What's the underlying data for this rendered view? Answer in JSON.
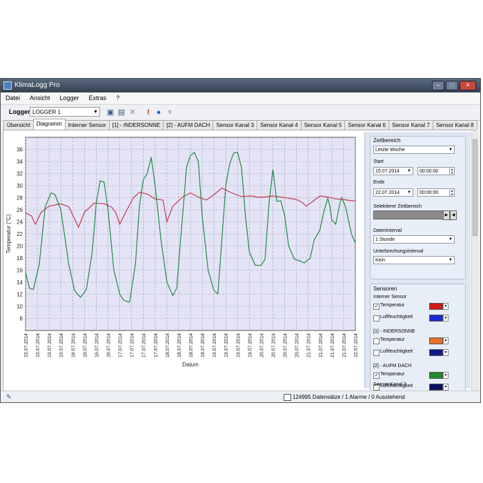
{
  "window": {
    "title": "KlimaLogg Pro",
    "controls": [
      "─",
      "□",
      "✕"
    ]
  },
  "menu": [
    "Datei",
    "Ansicht",
    "Logger",
    "Extras",
    "?"
  ],
  "toolbar": {
    "logger_label": "Logger",
    "logger_value": "LOGGER 1",
    "icons": [
      "open-folder-icon",
      "save-icon",
      "delete-x-icon",
      "alarm-exclamation-icon",
      "humidity-drop-icon",
      "sensor-key-icon"
    ]
  },
  "tabs": [
    "Übersicht",
    "Diagramm",
    "Interner Sensor",
    "[1] - INDERSONNE",
    "[2] - AUFM DACH",
    "Sensor Kanal 3",
    "Sensor Kanal 4",
    "Sensor Kanal 5",
    "Sensor Kanal 6",
    "Sensor Kanal 7",
    "Sensor Kanal 8"
  ],
  "active_tab": 1,
  "panel": {
    "zeitbereich_title": "Zeitbereich",
    "zeitbereich_value": "Letzte Woche",
    "start_label": "Start",
    "start_date": "15.07.2014",
    "start_time": "00:00:00",
    "ende_label": "Ende",
    "ende_date": "22.07.2014",
    "ende_time": "00:00:00",
    "selected_range_label": "Selektierer Zeitbereich",
    "dateninterval_label": "Dateninterval",
    "dateninterval_value": "1 Stunde",
    "unterbrechung_label": "Unterbrechungsinterval",
    "unterbrechung_value": "Kein",
    "sensoren_title": "Sensoren",
    "sensor_groups": [
      {
        "name": "Interner Sensor",
        "rows": [
          {
            "label": "Temperatur",
            "checked": true,
            "color": "#d11a1a"
          },
          {
            "label": "Luftfeuchtigkeit",
            "checked": false,
            "color": "#1a2bd1"
          }
        ]
      },
      {
        "name": "[1] - INDERSONNE",
        "rows": [
          {
            "label": "Temperatur",
            "checked": false,
            "color": "#e8702a"
          },
          {
            "label": "Luftfeuchtigkeit",
            "checked": false,
            "color": "#101a8a"
          }
        ]
      },
      {
        "name": "[2] - AUFM DACH",
        "rows": [
          {
            "label": "Temperatur",
            "checked": true,
            "color": "#1f8a2e"
          },
          {
            "label": "Luftfeuchtigkeit",
            "checked": false,
            "color": "#0a1060"
          }
        ]
      }
    ],
    "next_group_partial": "Sensor Kanal 3"
  },
  "status": {
    "text": "124995 Datensätze / 1 Alarme / 0 Ausstehend"
  },
  "chart_data": {
    "type": "line",
    "xlabel": "Datum",
    "ylabel": "Temperatur (°C)",
    "ylim": [
      6,
      38
    ],
    "yticks": [
      8,
      10,
      12,
      14,
      16,
      18,
      20,
      22,
      24,
      26,
      28,
      30,
      32,
      34,
      36
    ],
    "xlim": [
      0,
      168
    ],
    "x_tick_labels": [
      "15.07.2014",
      "15.07.2014",
      "15.07.2014",
      "15.07.2014",
      "16.07.2014",
      "16.07.2014",
      "16.07.2014",
      "16.07.2014",
      "17.07.2014",
      "17.07.2014",
      "17.07.2014",
      "17.07.2014",
      "18.07.2014",
      "18.07.2014",
      "18.07.2014",
      "18.07.2014",
      "19.07.2014",
      "19.07.2014",
      "19.07.2014",
      "19.07.2014",
      "20.07.2014",
      "20.07.2014",
      "20.07.2014",
      "20.07.2014",
      "21.07.2014",
      "21.07.2014",
      "21.07.2014",
      "21.07.2014",
      "22.07.2014"
    ],
    "x_tick_hours": [
      0,
      6,
      12,
      18,
      24,
      30,
      36,
      42,
      48,
      54,
      60,
      66,
      72,
      78,
      84,
      90,
      96,
      102,
      108,
      114,
      120,
      126,
      132,
      138,
      144,
      150,
      156,
      162,
      168
    ],
    "grid": true,
    "series": [
      {
        "color": "#c8364e",
        "points": [
          [
            0,
            25.5
          ],
          [
            3,
            25
          ],
          [
            5,
            23.6
          ],
          [
            8,
            25.6
          ],
          [
            12,
            26.6
          ],
          [
            18,
            27
          ],
          [
            22,
            26.5
          ],
          [
            25,
            24.5
          ],
          [
            27,
            23.1
          ],
          [
            30,
            25.6
          ],
          [
            35,
            27.1
          ],
          [
            40,
            27
          ],
          [
            44,
            26.4
          ],
          [
            46,
            25.5
          ],
          [
            48,
            23.6
          ],
          [
            51,
            25.6
          ],
          [
            55,
            28
          ],
          [
            58,
            28.9
          ],
          [
            62,
            28.6
          ],
          [
            66,
            27.8
          ],
          [
            70,
            27.6
          ],
          [
            72,
            24
          ],
          [
            75,
            26.6
          ],
          [
            80,
            28.1
          ],
          [
            84,
            28.8
          ],
          [
            88,
            28.1
          ],
          [
            92,
            27.6
          ],
          [
            96,
            28.5
          ],
          [
            100,
            29.6
          ],
          [
            105,
            28.8
          ],
          [
            110,
            28.2
          ],
          [
            115,
            28.3
          ],
          [
            118,
            28.1
          ],
          [
            122,
            28.1
          ],
          [
            126,
            28.3
          ],
          [
            130,
            28.1
          ],
          [
            134,
            27.9
          ],
          [
            138,
            27.7
          ],
          [
            141,
            27.2
          ],
          [
            143,
            26.6
          ],
          [
            146,
            27.3
          ],
          [
            150,
            28.3
          ],
          [
            154,
            28.1
          ],
          [
            158,
            27.8
          ],
          [
            162,
            27.7
          ],
          [
            166,
            27.5
          ],
          [
            168,
            27.5
          ]
        ]
      },
      {
        "color": "#1f8a40",
        "points": [
          [
            0,
            15.6
          ],
          [
            2,
            13
          ],
          [
            4,
            12.8
          ],
          [
            7,
            17
          ],
          [
            10,
            26.5
          ],
          [
            13,
            28.8
          ],
          [
            15,
            28.5
          ],
          [
            18,
            26
          ],
          [
            22,
            17
          ],
          [
            25,
            12.6
          ],
          [
            28,
            11.5
          ],
          [
            31,
            12.8
          ],
          [
            34,
            19
          ],
          [
            36,
            27
          ],
          [
            38,
            30.8
          ],
          [
            40,
            30.6
          ],
          [
            42,
            26
          ],
          [
            45,
            16
          ],
          [
            48,
            12
          ],
          [
            50,
            11
          ],
          [
            53,
            10.7
          ],
          [
            56,
            17
          ],
          [
            58,
            26.5
          ],
          [
            60,
            31
          ],
          [
            62,
            32
          ],
          [
            64,
            34.7
          ],
          [
            66,
            30
          ],
          [
            69,
            21
          ],
          [
            72,
            14
          ],
          [
            75,
            11.8
          ],
          [
            77,
            13
          ],
          [
            80,
            25
          ],
          [
            82,
            33
          ],
          [
            84,
            35
          ],
          [
            86,
            35.5
          ],
          [
            88,
            34
          ],
          [
            90,
            25
          ],
          [
            93,
            16
          ],
          [
            96,
            12.6
          ],
          [
            98,
            12.1
          ],
          [
            100,
            21
          ],
          [
            102,
            30
          ],
          [
            104,
            33.6
          ],
          [
            106,
            35.4
          ],
          [
            108,
            35.5
          ],
          [
            110,
            33
          ],
          [
            112,
            25
          ],
          [
            114,
            19
          ],
          [
            117,
            16.8
          ],
          [
            120,
            16.8
          ],
          [
            122,
            17.8
          ],
          [
            124,
            27
          ],
          [
            126,
            32.7
          ],
          [
            128,
            27.4
          ],
          [
            130,
            27.5
          ],
          [
            132,
            25
          ],
          [
            134,
            20
          ],
          [
            137,
            17.8
          ],
          [
            140,
            17.5
          ],
          [
            142,
            17.2
          ],
          [
            145,
            18
          ],
          [
            147,
            21
          ],
          [
            150,
            22.7
          ],
          [
            152,
            25.8
          ],
          [
            154,
            27.9
          ],
          [
            155,
            26.6
          ],
          [
            156,
            24.3
          ],
          [
            158,
            23.6
          ],
          [
            160,
            26.8
          ],
          [
            161,
            28
          ],
          [
            163,
            26.5
          ],
          [
            166,
            22
          ],
          [
            168,
            20.5
          ]
        ]
      }
    ]
  }
}
